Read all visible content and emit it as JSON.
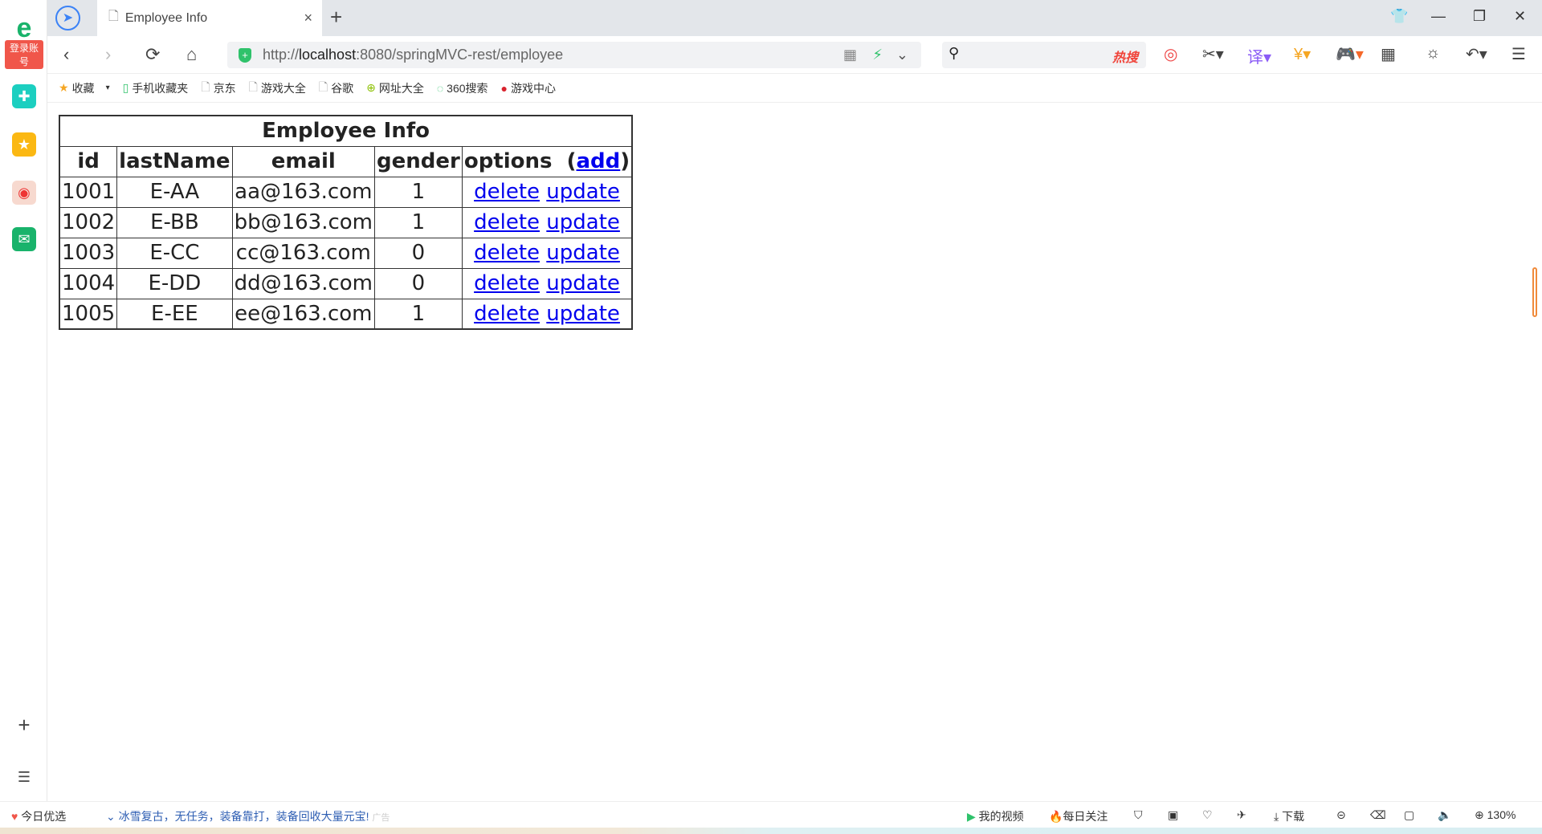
{
  "sidebar": {
    "login_label": "登录账号",
    "icons": [
      "browser-logo-icon",
      "clover-icon",
      "star-icon",
      "weibo-icon",
      "mail-icon",
      "plus-icon",
      "list-icon"
    ]
  },
  "tab": {
    "title": "Employee Info",
    "close": "×",
    "new_tab": "+"
  },
  "window": {
    "skin": "👕",
    "minimize": "—",
    "restore": "❐",
    "close": "✕"
  },
  "nav": {
    "back": "‹",
    "forward": "›",
    "reload": "⟳",
    "home": "⌂"
  },
  "address": {
    "prefix": "http://",
    "host": "localhost",
    "rest": ":8080/springMVC-rest/employee"
  },
  "search": {
    "hot_label": "热搜"
  },
  "bookmarks": [
    {
      "label": "收藏",
      "icon": "★"
    },
    {
      "label": "手机收藏夹",
      "icon": "▯"
    },
    {
      "label": "京东",
      "icon": "🗋"
    },
    {
      "label": "游戏大全",
      "icon": "🗋"
    },
    {
      "label": "谷歌",
      "icon": "🗋"
    },
    {
      "label": "网址大全",
      "icon": "⊕"
    },
    {
      "label": "360搜索",
      "icon": "◌"
    },
    {
      "label": "游戏中心",
      "icon": "●"
    }
  ],
  "table": {
    "title": "Employee Info",
    "headers": [
      "id",
      "lastName",
      "email",
      "gender",
      "options"
    ],
    "add_label": "add",
    "rows": [
      {
        "id": "1001",
        "lastName": "E-AA",
        "email": "aa@163.com",
        "gender": "1"
      },
      {
        "id": "1002",
        "lastName": "E-BB",
        "email": "bb@163.com",
        "gender": "1"
      },
      {
        "id": "1003",
        "lastName": "E-CC",
        "email": "cc@163.com",
        "gender": "0"
      },
      {
        "id": "1004",
        "lastName": "E-DD",
        "email": "dd@163.com",
        "gender": "0"
      },
      {
        "id": "1005",
        "lastName": "E-EE",
        "email": "ee@163.com",
        "gender": "1"
      }
    ],
    "delete_label": "delete",
    "update_label": "update"
  },
  "status": {
    "today": "今日优选",
    "ad_text": "冰雪复古，无任务，装备靠打，装备回收大量元宝!",
    "ad_tag": "广告",
    "my_video": "我的视频",
    "daily": "每日关注",
    "download": "下载",
    "zoom": "130%"
  }
}
